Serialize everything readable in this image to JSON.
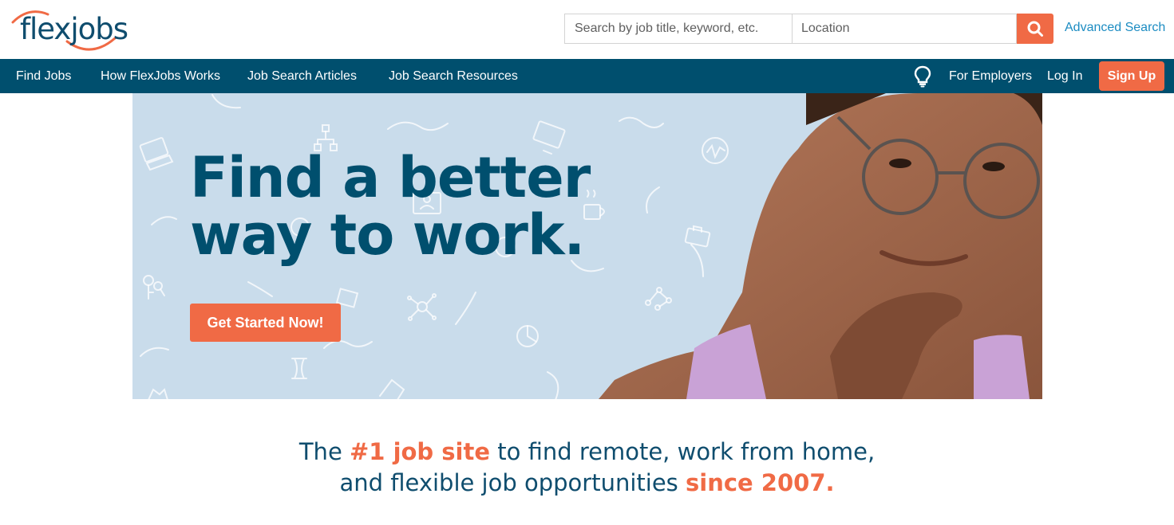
{
  "header": {
    "logo_text": "flexjobs",
    "search_placeholder": "Search by job title, keyword, etc.",
    "search_value": "",
    "location_placeholder": "Location",
    "location_value": "",
    "search_button_icon": "search-icon",
    "advanced_search_label": "Advanced Search"
  },
  "nav": {
    "left_items": [
      {
        "label": "Find Jobs"
      },
      {
        "label": "How FlexJobs Works"
      },
      {
        "label": "Job Search Articles"
      },
      {
        "label": "Job Search Resources"
      }
    ],
    "bulb_icon": "lightbulb-icon",
    "for_employers_label": "For Employers",
    "login_label": "Log In",
    "signup_label": "Sign Up"
  },
  "hero": {
    "headline_line1": "Find a better",
    "headline_line2": "way to work.",
    "cta_label": "Get Started Now!",
    "image_description": "Smiling woman wearing glasses, hand on chin"
  },
  "tagline": {
    "part1": "The ",
    "highlight1": "#1 job site",
    "part2": " to find remote, work from home,",
    "part3": "and flexible job opportunities ",
    "highlight2": "since 2007."
  },
  "colors": {
    "brand_navy": "#004f6e",
    "accent_orange": "#f06a45",
    "link_blue": "#1c8cc2",
    "hero_bg": "#c9dceb"
  }
}
